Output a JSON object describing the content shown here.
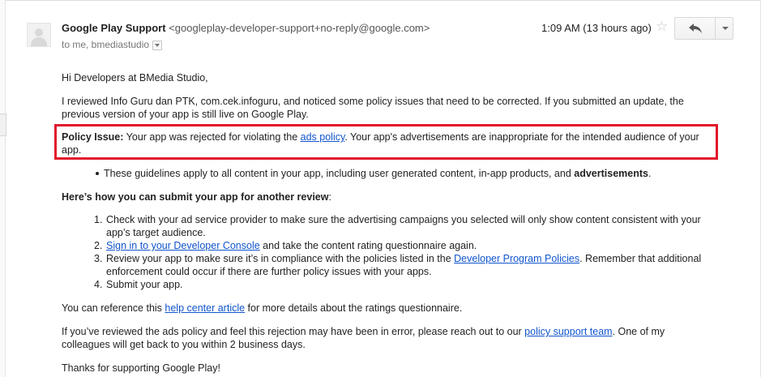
{
  "header": {
    "sender_name": "Google Play Support",
    "sender_email": "<googleplay-developer-support+no-reply@google.com>",
    "to_line": "to me, bmediastudio",
    "time": "1:09 AM (13 hours ago)"
  },
  "icons": {
    "star": "star-outline-icon",
    "reply": "reply-arrow-icon",
    "more": "chevron-down-icon"
  },
  "body": {
    "greeting": "Hi Developers at BMedia Studio,",
    "intro": "I reviewed Info Guru dan PTK, com.cek.infoguru, and noticed some policy issues that need to be corrected. If you submitted an update, the previous version of your app is still live on Google Play.",
    "policy_label": "Policy Issue:",
    "policy_pre": " Your app was rejected for violating the ",
    "policy_link": "ads policy",
    "policy_post": ". Your app's advertisements are inappropriate for the intended audience of your app.",
    "bullet_text": "These guidelines apply to all content in your app, including user generated content, in-app products, and ",
    "bullet_bold": "advertisements",
    "bullet_end": ".",
    "howto_heading": "Here’s how you can submit your app for another review",
    "howto_colon": ":",
    "steps": [
      {
        "num": "1.",
        "text": "Check with your ad service provider to make sure the advertising campaigns you selected will only show content consistent with your app’s target audience."
      },
      {
        "num": "2.",
        "link": "Sign in to your Developer Console",
        "text": " and take the content rating questionnaire again."
      },
      {
        "num": "3.",
        "pre": "Review your app to make sure it’s in compliance with the policies listed in the ",
        "link": "Developer Program Policies",
        "post": ". Remember that additional enforcement could occur if there are further policy issues with your apps."
      },
      {
        "num": "4.",
        "text": "Submit your app."
      }
    ],
    "reference_pre": "You can reference this ",
    "reference_link": "help center article",
    "reference_post": " for more details about the ratings questionnaire.",
    "review_pre": "If you’ve reviewed the ads policy and feel this rejection may have been in error, please reach out to our ",
    "review_link": "policy support team",
    "review_post": ". One of my colleagues will get back to you within 2 business days.",
    "thanks": "Thanks for supporting Google Play!"
  },
  "colors": {
    "link": "#1155cc",
    "highlight_border": "#e2182b",
    "text": "#222222"
  }
}
